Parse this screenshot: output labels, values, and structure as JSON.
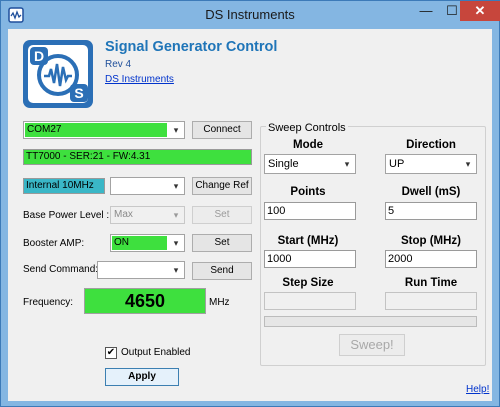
{
  "window": {
    "title": "DS Instruments",
    "minimize": "—",
    "maximize": "☐",
    "close": "✕"
  },
  "header": {
    "title": "Signal Generator Control",
    "rev": "Rev 4",
    "link": "DS Instruments",
    "logo_letters": [
      "D",
      "S"
    ]
  },
  "connection": {
    "port": "COM27",
    "connect_label": "Connect",
    "status": "TT7000 - SER:21 - FW:4.31"
  },
  "reference": {
    "current": "Internal 10MHz",
    "select_value": "",
    "change_label": "Change Ref"
  },
  "base_power": {
    "label": "Base Power Level :",
    "value": "Max",
    "set_label": "Set"
  },
  "booster": {
    "label": "Booster AMP:",
    "value": "ON",
    "set_label": "Set"
  },
  "command": {
    "label": "Send Command:",
    "value": "",
    "send_label": "Send"
  },
  "frequency": {
    "label": "Frequency:",
    "value": "4650",
    "unit": "MHz"
  },
  "output": {
    "label": "Output Enabled",
    "checked": true,
    "check_glyph": "✔"
  },
  "apply_label": "Apply",
  "sweep": {
    "group_title": "Sweep Controls",
    "mode_label": "Mode",
    "mode_value": "Single",
    "direction_label": "Direction",
    "direction_value": "UP",
    "points_label": "Points",
    "points_value": "100",
    "dwell_label": "Dwell (mS)",
    "dwell_value": "5",
    "start_label": "Start (MHz)",
    "start_value": "1000",
    "stop_label": "Stop (MHz)",
    "stop_value": "2000",
    "step_label": "Step Size",
    "step_value": "",
    "runtime_label": "Run Time",
    "runtime_value": "",
    "progress": 0,
    "sweep_label": "Sweep!"
  },
  "help_link": "Help!",
  "colors": {
    "status_green": "#3ee03e",
    "ref_teal": "#3ab7c7",
    "title_blue": "#1f75b8",
    "titlebar": "#84b6e2",
    "close_red": "#c7463c"
  },
  "icons": {
    "dropdown": "▾"
  }
}
